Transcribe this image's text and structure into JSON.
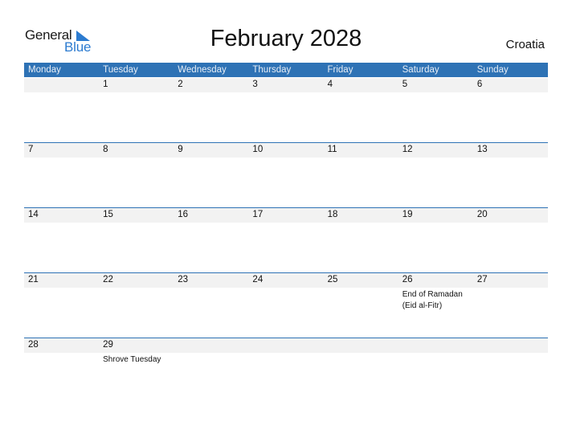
{
  "logo": {
    "text_general": "General",
    "text_blue": "Blue",
    "icon": "triangle-flag-icon"
  },
  "title": "February 2028",
  "country": "Croatia",
  "colors": {
    "header_bg": "#2e72b5",
    "date_strip": "#f2f2f2",
    "logo_blue": "#2c7bd0"
  },
  "weekdays": [
    "Monday",
    "Tuesday",
    "Wednesday",
    "Thursday",
    "Friday",
    "Saturday",
    "Sunday"
  ],
  "weeks": [
    {
      "days": [
        {
          "num": "",
          "event": ""
        },
        {
          "num": "1",
          "event": ""
        },
        {
          "num": "2",
          "event": ""
        },
        {
          "num": "3",
          "event": ""
        },
        {
          "num": "4",
          "event": ""
        },
        {
          "num": "5",
          "event": ""
        },
        {
          "num": "6",
          "event": ""
        }
      ]
    },
    {
      "days": [
        {
          "num": "7",
          "event": ""
        },
        {
          "num": "8",
          "event": ""
        },
        {
          "num": "9",
          "event": ""
        },
        {
          "num": "10",
          "event": ""
        },
        {
          "num": "11",
          "event": ""
        },
        {
          "num": "12",
          "event": ""
        },
        {
          "num": "13",
          "event": ""
        }
      ]
    },
    {
      "days": [
        {
          "num": "14",
          "event": ""
        },
        {
          "num": "15",
          "event": ""
        },
        {
          "num": "16",
          "event": ""
        },
        {
          "num": "17",
          "event": ""
        },
        {
          "num": "18",
          "event": ""
        },
        {
          "num": "19",
          "event": ""
        },
        {
          "num": "20",
          "event": ""
        }
      ]
    },
    {
      "days": [
        {
          "num": "21",
          "event": ""
        },
        {
          "num": "22",
          "event": ""
        },
        {
          "num": "23",
          "event": ""
        },
        {
          "num": "24",
          "event": ""
        },
        {
          "num": "25",
          "event": ""
        },
        {
          "num": "26",
          "event": "End of Ramadan",
          "event2": "(Eid al-Fitr)"
        },
        {
          "num": "27",
          "event": ""
        }
      ]
    },
    {
      "days": [
        {
          "num": "28",
          "event": ""
        },
        {
          "num": "29",
          "event": "Shrove Tuesday"
        },
        {
          "num": "",
          "event": ""
        },
        {
          "num": "",
          "event": ""
        },
        {
          "num": "",
          "event": ""
        },
        {
          "num": "",
          "event": ""
        },
        {
          "num": "",
          "event": ""
        }
      ]
    }
  ]
}
